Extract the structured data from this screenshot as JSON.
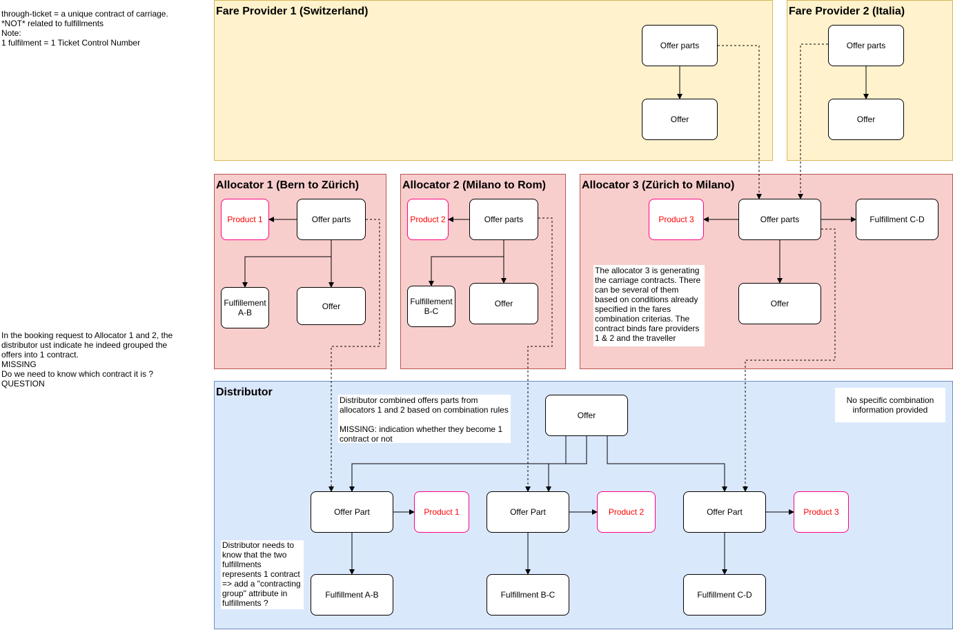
{
  "notes": {
    "top_left": "through-ticket = a unique contract of carriage.\n*NOT* related to fulfillments\nNote:\n1 fulfilment = 1 Ticket Control Number",
    "mid_left": "In the booking request to Allocator 1 and 2, the\ndistributor ust indicate he indeed grouped the\noffers into 1 contract.\nMISSING\n Do we need to know which contract it is ?\nQUESTION",
    "allocator3": "The allocator 3 is generating the carriage contracts. There can be several of them based on conditions already specified in the fares combination criterias. The contract binds fare providers 1 & 2 and the traveller",
    "distributor_combined": "Distributor combined offers parts from allocators 1 and 2 based on combination rules\n\nMISSING: indication whether they become 1 contract or not",
    "distributor_no_combination": "No specific combination information provided",
    "distributor_fulfillments": "Distributor needs to know that the two fulfillments represents 1 contract\n=> add a \"contracting group\" attribute  in fulfillments ?"
  },
  "fare_provider_1": {
    "title": "Fare Provider 1 (Switzerland)",
    "offer_parts": "Offer parts",
    "offer": "Offer"
  },
  "fare_provider_2": {
    "title": "Fare Provider 2 (Italia)",
    "offer_parts": "Offer parts",
    "offer": "Offer"
  },
  "allocator_1": {
    "title": "Allocator 1 (Bern to Zürich)",
    "product": "Product 1",
    "offer_parts": "Offer parts",
    "fulfillment": "Fulfillement A-B",
    "offer": "Offer"
  },
  "allocator_2": {
    "title": "Allocator 2 (Milano to Rom)",
    "product": "Product 2",
    "offer_parts": "Offer parts",
    "fulfillment": "Fulfillement B-C",
    "offer": "Offer"
  },
  "allocator_3": {
    "title": "Allocator 3 (Zürich to Milano)",
    "product": "Product 3",
    "offer_parts": "Offer parts",
    "fulfillment": "Fulfillment C-D",
    "offer": "Offer"
  },
  "distributor": {
    "title": "Distributor",
    "offer": "Offer",
    "parts": [
      {
        "offer_part": "Offer Part",
        "product": "Product 1",
        "fulfillment": "Fulfillment A-B"
      },
      {
        "offer_part": "Offer Part",
        "product": "Product 2",
        "fulfillment": "Fulfillment B-C"
      },
      {
        "offer_part": "Offer Part",
        "product": "Product 3",
        "fulfillment": "Fulfillment C-D"
      }
    ]
  },
  "colors": {
    "fare_provider_fill": "#fff2cc",
    "allocator_fill": "#f8cecc",
    "distributor_fill": "#dae8fc",
    "product_border": "#ff0080",
    "product_text": "#ff0000"
  }
}
